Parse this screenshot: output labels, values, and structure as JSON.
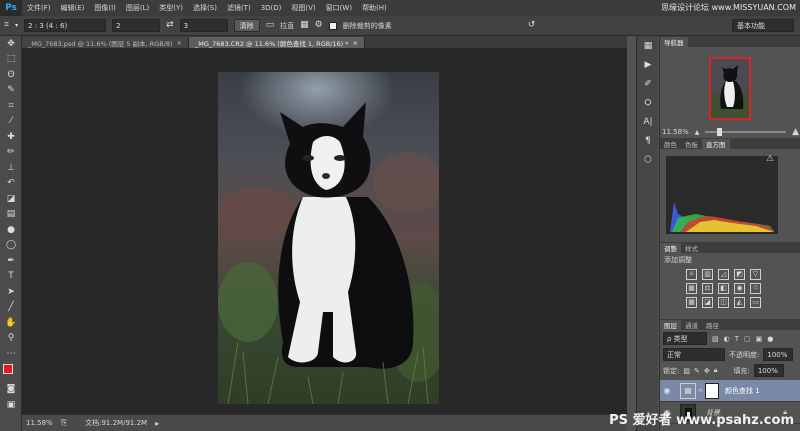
{
  "app": {
    "logo": "Ps"
  },
  "menu": [
    "文件(F)",
    "编辑(E)",
    "图像(I)",
    "图层(L)",
    "类型(Y)",
    "选择(S)",
    "滤镜(T)",
    "3D(D)",
    "视图(V)",
    "窗口(W)",
    "帮助(H)"
  ],
  "watermark_top": "思缘设计论坛 www.MISSYUAN.COM",
  "options": {
    "ratio": "2 : 3 (4 : 6)",
    "width": "2",
    "height": "3",
    "clear_button": "清除",
    "straighten_label": "拉直",
    "delete_cropped_label": "删除裁剪的像素",
    "workspace": "基本功能"
  },
  "tabs": [
    {
      "label": "_MG_7683.psd @ 11.6% (图层 5 副本, RGB/8)",
      "close": "×"
    },
    {
      "label": "_MG_7683.CR2 @ 11.6% (颜色查找 1, RGB/16) *",
      "close": "×"
    }
  ],
  "status": {
    "zoom": "11.58%",
    "doc": "文档:91.2M/91.2M"
  },
  "navigator": {
    "tab": "导航器",
    "zoom": "11.58%"
  },
  "color_tabs": [
    "颜色",
    "色板",
    "直方图"
  ],
  "adjust": {
    "tabs": [
      "调整",
      "样式"
    ],
    "title": "添加调整"
  },
  "layers": {
    "tabs": [
      "图层",
      "通道",
      "路径"
    ],
    "filter": "ρ 类型",
    "blend": "正常",
    "opacity_label": "不透明度:",
    "opacity": "100%",
    "lock_label": "锁定:",
    "fill_label": "填充:",
    "fill": "100%",
    "items": [
      {
        "name": "颜色查找 1"
      },
      {
        "name": "背景"
      }
    ]
  },
  "watermark_bottom": "PS 爱好者 www.psahz.com"
}
